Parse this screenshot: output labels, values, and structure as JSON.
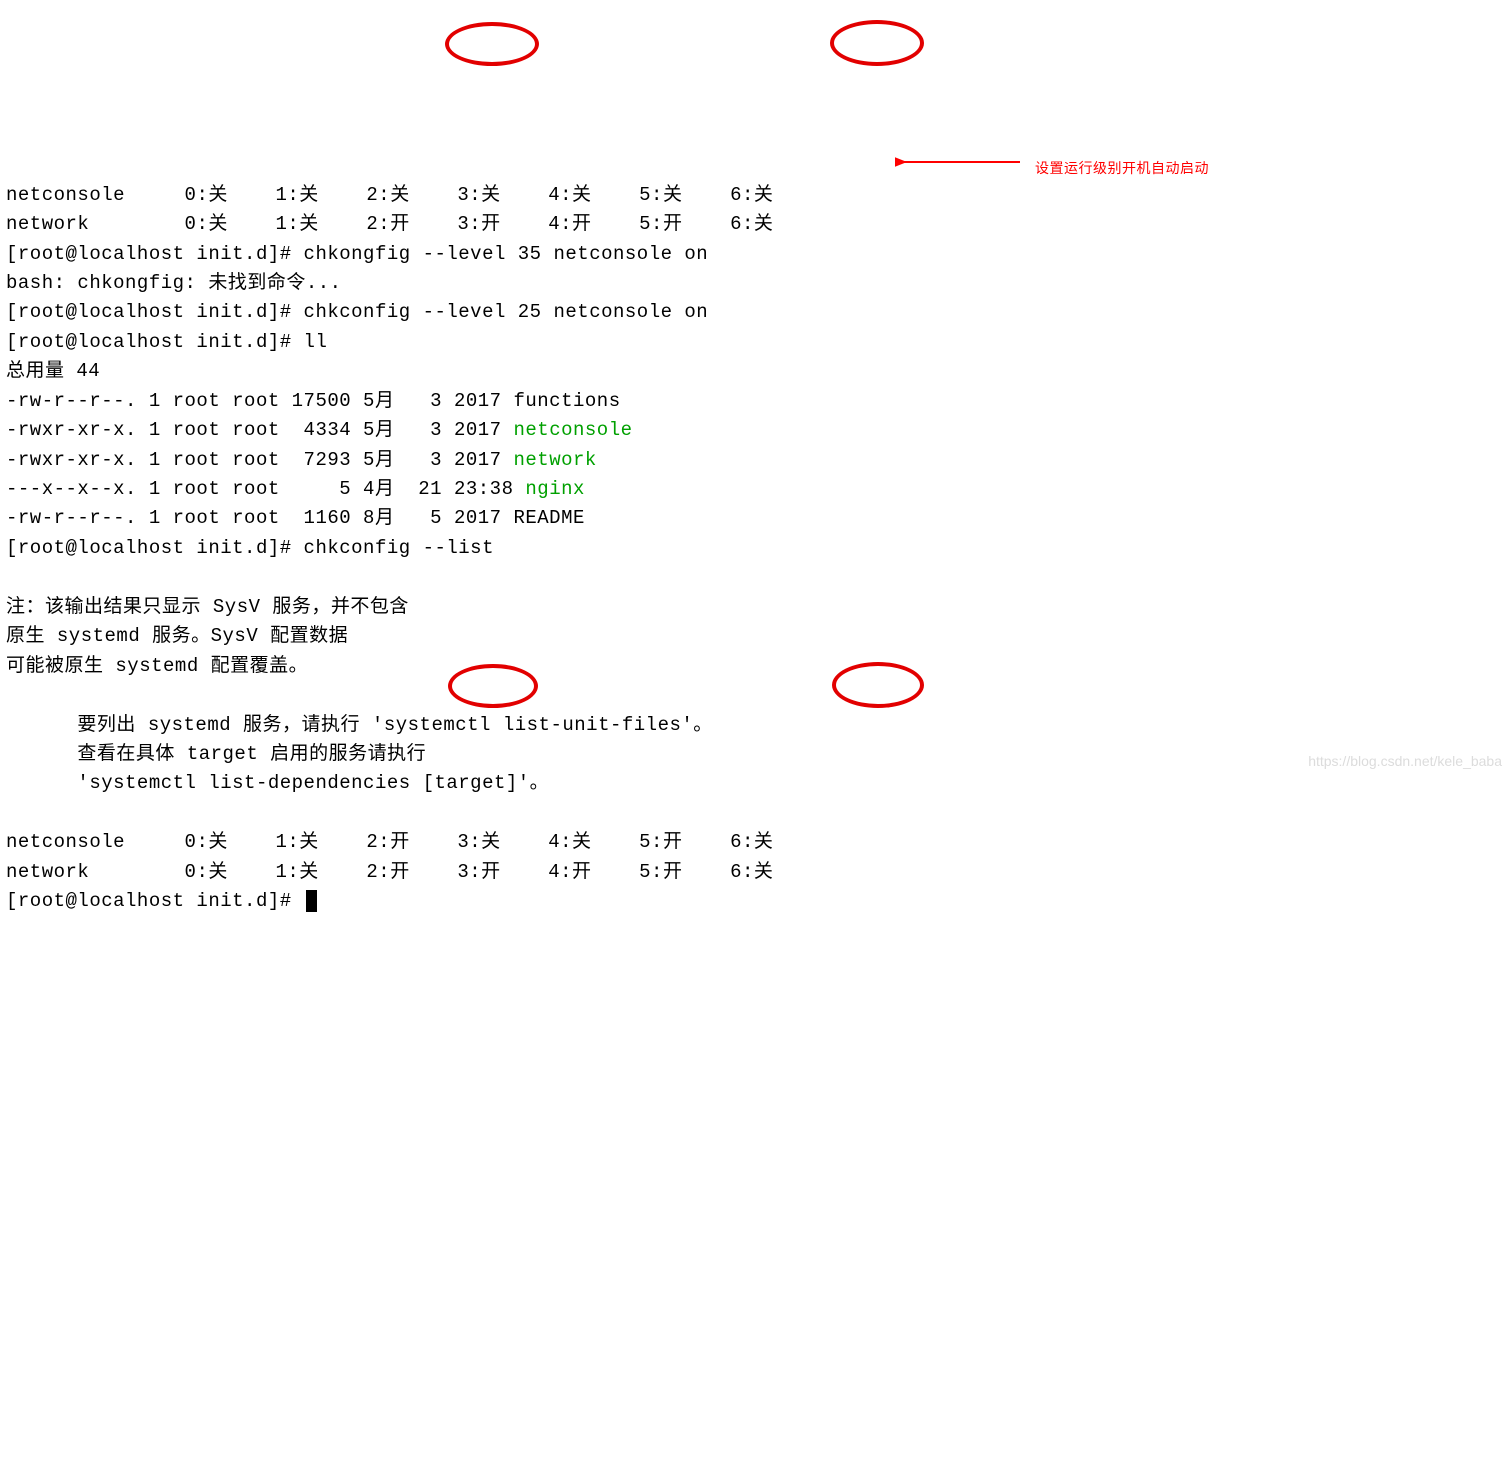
{
  "lines": {
    "row1_name": "netconsole",
    "row1_levels": [
      "0:关",
      "1:关",
      "2:关",
      "3:关",
      "4:关",
      "5:关",
      "6:关"
    ],
    "row2_name": "network",
    "row2_levels": [
      "0:关",
      "1:关",
      "2:开",
      "3:开",
      "4:开",
      "5:开",
      "6:关"
    ],
    "prompt1": "[root@localhost init.d]# chkongfig --level 35 netconsole on",
    "bash_err": "bash: chkongfig: 未找到命令...",
    "prompt2": "[root@localhost init.d]# chkconfig --level 25 netconsole on",
    "prompt3": "[root@localhost init.d]# ll",
    "total": "总用量 44",
    "f1": "-rw-r--r--. 1 root root 17500 5月   3 2017 functions",
    "f2a": "-rwxr-xr-x. 1 root root  4334 5月   3 2017 ",
    "f2b": "netconsole",
    "f3a": "-rwxr-xr-x. 1 root root  7293 5月   3 2017 ",
    "f3b": "network",
    "f4a": "---x--x--x. 1 root root     5 4月  21 23:38 ",
    "f4b": "nginx",
    "f5": "-rw-r--r--. 1 root root  1160 8月   5 2017 README",
    "prompt4": "[root@localhost init.d]# chkconfig --list",
    "note1": "注：该输出结果只显示 SysV 服务，并不包含",
    "note2": "原生 systemd 服务。SysV 配置数据",
    "note3": "可能被原生 systemd 配置覆盖。",
    "note4": "      要列出 systemd 服务，请执行 'systemctl list-unit-files'。",
    "note5": "      查看在具体 target 启用的服务请执行",
    "note6": "      'systemctl list-dependencies [target]'。",
    "row3_name": "netconsole",
    "row3_levels": [
      "0:关",
      "1:关",
      "2:开",
      "3:关",
      "4:关",
      "5:开",
      "6:关"
    ],
    "row4_name": "network",
    "row4_levels": [
      "0:关",
      "1:关",
      "2:开",
      "3:开",
      "4:开",
      "5:开",
      "6:关"
    ],
    "prompt5": "[root@localhost init.d]# "
  },
  "annotation_text": "设置运行级别开机自动启动",
  "watermark": "https://blog.csdn.net/kele_baba"
}
